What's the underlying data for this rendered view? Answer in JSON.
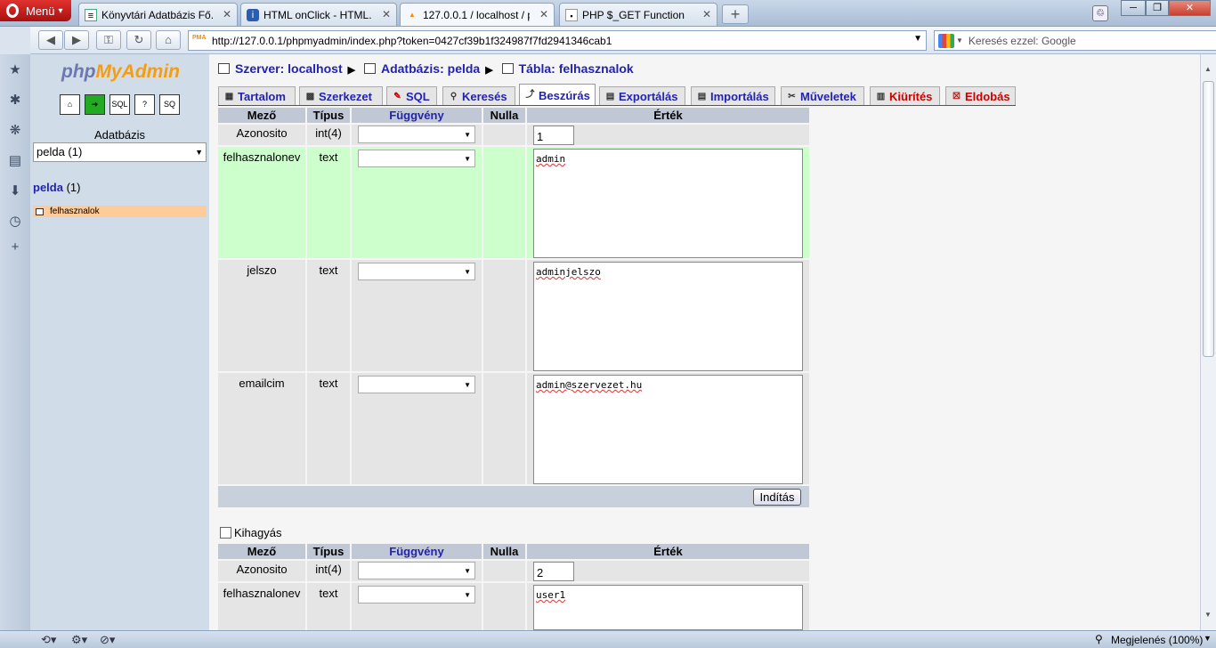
{
  "browser": {
    "menu_label": "Menü",
    "tabs": [
      {
        "label": "Könyvtári Adatbázis Fő...",
        "icon": "document-icon"
      },
      {
        "label": "HTML onClick - HTML...",
        "icon": "info-icon"
      },
      {
        "label": "127.0.0.1 / localhost / p...",
        "icon": "pma-icon"
      },
      {
        "label": "PHP $_GET Function",
        "icon": "w3-icon"
      }
    ],
    "new_tab": "+",
    "url": "http://127.0.0.1/phpmyadmin/index.php?token=0427cf39b1f324987f7fd2941346cab1",
    "search_placeholder": "Keresés ezzel: Google",
    "zoom_label": "Megjelenés (100%)"
  },
  "sidebar": {
    "logo_php": "php",
    "logo_my": "My",
    "logo_admin": "Admin",
    "db_label": "Adatbázis",
    "db_selected": "pelda (1)",
    "db_name": "pelda",
    "db_count": "(1)",
    "table_name": "felhasznalok",
    "icons": [
      "home-icon",
      "exit-icon",
      "sql-icon",
      "docs-icon",
      "sql-docs-icon"
    ]
  },
  "breadcrumb": {
    "server": "Szerver: localhost",
    "database": "Adatbázis: pelda",
    "table": "Tábla: felhasznalok"
  },
  "tabs": [
    {
      "label": "Tartalom",
      "color": "#2323b1"
    },
    {
      "label": "Szerkezet",
      "color": "#2323b1"
    },
    {
      "label": "SQL",
      "color": "#2323b1"
    },
    {
      "label": "Keresés",
      "color": "#2323b1"
    },
    {
      "label": "Beszúrás",
      "color": "#2323b1"
    },
    {
      "label": "Exportálás",
      "color": "#2323b1"
    },
    {
      "label": "Importálás",
      "color": "#2323b1"
    },
    {
      "label": "Műveletek",
      "color": "#2323b1"
    },
    {
      "label": "Kiürítés",
      "color": "#cc0000"
    },
    {
      "label": "Eldobás",
      "color": "#cc0000"
    }
  ],
  "table_headers": {
    "field": "Mező",
    "type": "Típus",
    "function": "Függvény",
    "null": "Nulla",
    "value": "Érték"
  },
  "form1": {
    "rows": [
      {
        "field": "Azonosito",
        "type": "int(4)",
        "value": "1"
      },
      {
        "field": "felhasznalonev",
        "type": "text",
        "value": "admin"
      },
      {
        "field": "jelszo",
        "type": "text",
        "value": "adminjelszo"
      },
      {
        "field": "emailcim",
        "type": "text",
        "value": "admin@szervezet.hu"
      }
    ],
    "go_label": "Indítás"
  },
  "skip_label": "Kihagyás",
  "form2": {
    "rows": [
      {
        "field": "Azonosito",
        "type": "int(4)",
        "value": "2"
      },
      {
        "field": "felhasznalonev",
        "type": "text",
        "value": "user1"
      }
    ]
  }
}
